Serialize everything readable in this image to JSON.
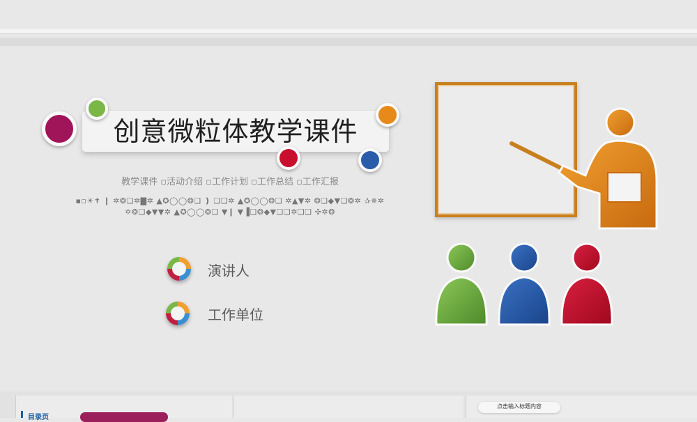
{
  "title": "创意微粒体教学课件",
  "subtitle": "教学课件 ▫活动介绍 ▫工作计划 ▫工作总结 ▫工作汇报",
  "garbled_line1": "▪▫☀✝ ❙ ✲❂❏✲▇✲ ▲✪◯◯❂❏ ❫ ❏❏✲ ▲✪◯◯❂❏ ✲▲▼✲ ❂❏◆▼❏❂✲ ✰✵✲",
  "garbled_line2": "✡❂❏◆▼▼✲ ▲✪◯◯❂❏ ▼❙ ▼▐❏❂◆▼❏❏✲❏❏ ✣✲❂",
  "presenter_label": "演讲人",
  "unit_label": "工作单位",
  "thumb_left_label": "目录页",
  "thumb_right_caption": "点击输入标题内容",
  "colors": {
    "magenta": "#a0145a",
    "green": "#7ab648",
    "orange": "#e88a1a",
    "red": "#c8102e",
    "blue": "#2a5caa",
    "board_border": "#c8801e"
  },
  "icons": [
    "presenter-figure-icon",
    "audience-green-icon",
    "audience-blue-icon",
    "audience-red-icon",
    "info-bullet-icon"
  ]
}
